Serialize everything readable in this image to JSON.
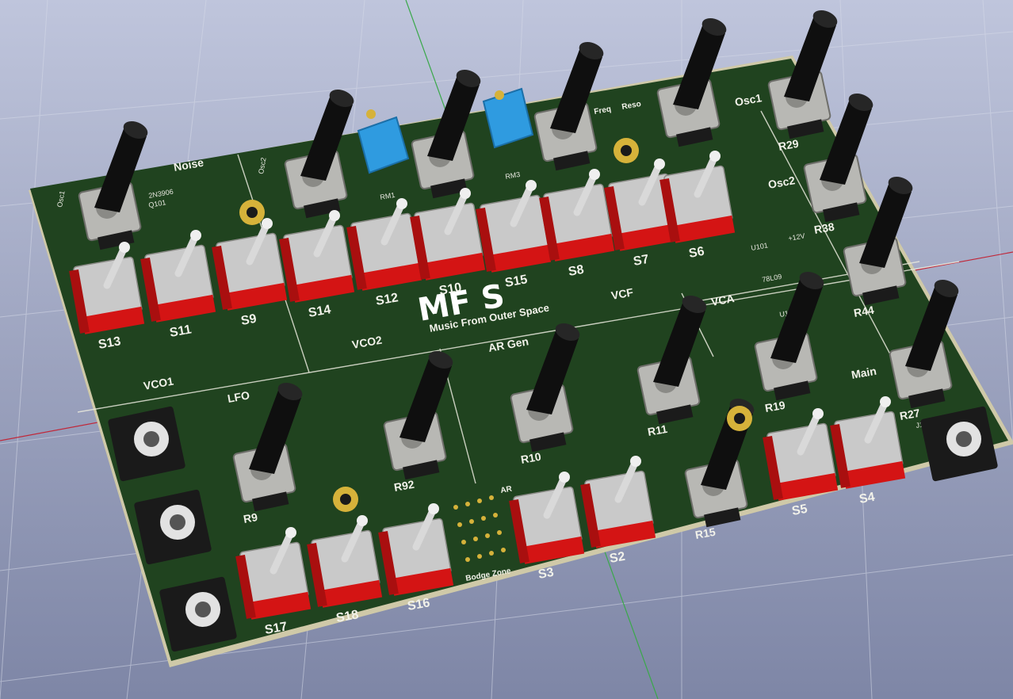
{
  "colors": {
    "background_top": "#bfc5dc",
    "background_bottom": "#7e86a6",
    "pcb_green": "#20431f",
    "pcb_edge": "#cfc9a8",
    "silkscreen": "#f2f2ea",
    "switch_red": "#d41414",
    "switch_body": "#c9c9c9",
    "knob_black": "#0f0f0f",
    "trimmer_blue": "#2f9be0",
    "pad_gold": "#d6b23a",
    "axis_red": "#c0283a",
    "axis_green": "#3aa84a"
  },
  "board": {
    "logo_mark": "MF S",
    "logo_subtitle": "Music From Outer Space",
    "section_labels": [
      "Noise",
      "VCO1",
      "LFO",
      "VCO2",
      "AR Gen",
      "VCF",
      "VCA",
      "Osc1",
      "Osc2",
      "Main",
      "Freq",
      "Reso",
      "Bodge Zone",
      "AR"
    ],
    "small_labels": [
      "Osc1",
      "Osc2",
      "2N3906",
      "Q101",
      "RM1",
      "RM3",
      "+12V",
      "U101",
      "U102",
      "78L09",
      "J1"
    ],
    "switches": [
      "S13",
      "S11",
      "S9",
      "S14",
      "S12",
      "S10",
      "S15",
      "S8",
      "S7",
      "S6",
      "S17",
      "S18",
      "S16",
      "S3",
      "S2",
      "S5",
      "S4"
    ],
    "potentiometers": [
      "R29",
      "R38",
      "R44",
      "R27",
      "R19",
      "R11",
      "R15",
      "R10",
      "R92",
      "R9"
    ]
  }
}
